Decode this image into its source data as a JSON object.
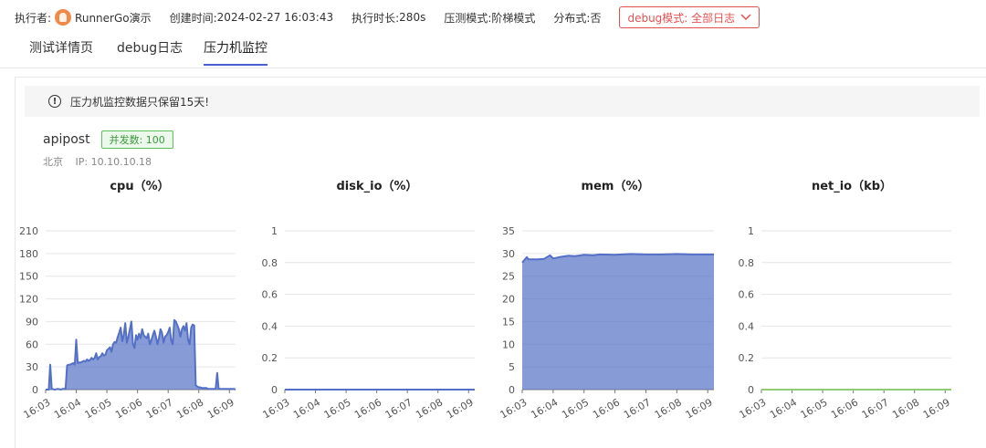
{
  "header": {
    "executor_label": "执行者:",
    "executor_name": "RunnerGo演示",
    "created_label": "创建时间:",
    "created_value": "2024-02-27 16:03:43",
    "duration_label": "执行时长:",
    "duration_value": "280s",
    "mode_label": "压测模式:",
    "mode_value": "阶梯模式",
    "distributed_label": "分布式:",
    "distributed_value": "否",
    "debug_select": "debug模式: 全部日志"
  },
  "tabs": [
    {
      "label": "测试详情页",
      "active": false
    },
    {
      "label": "debug日志",
      "active": false
    },
    {
      "label": "压力机监控",
      "active": true
    }
  ],
  "notice": {
    "icon": "exclamation-icon",
    "text": "压力机监控数据只保留15天!"
  },
  "machine": {
    "name": "apipost",
    "concurrency": "并发数: 100",
    "region": "北京",
    "ip": "IP: 10.10.10.18"
  },
  "chart_data": [
    {
      "type": "area",
      "title": "cpu（%）",
      "x_ticks": [
        "16:03",
        "16:04",
        "16:05",
        "16:06",
        "16:07",
        "16:08",
        "16:09"
      ],
      "y_ticks": [
        0,
        30,
        60,
        90,
        120,
        150,
        180,
        210
      ],
      "ylim": [
        0,
        210
      ],
      "color": "#5470c6",
      "x": [
        0,
        0.1,
        0.15,
        0.2,
        0.3,
        0.4,
        0.5,
        0.55,
        0.6,
        0.65,
        0.7,
        0.75,
        0.8,
        0.85,
        0.9,
        0.95,
        1,
        1.05,
        1.1,
        1.15,
        1.2,
        1.25,
        1.3,
        1.35,
        1.4,
        1.45,
        1.5,
        1.55,
        1.6,
        1.65,
        1.7,
        1.75,
        1.8,
        1.85,
        1.9,
        1.95,
        2,
        2.05,
        2.1,
        2.15,
        2.2,
        2.25,
        2.3,
        2.35,
        2.4,
        2.45,
        2.5,
        2.55,
        2.6,
        2.65,
        2.7,
        2.75,
        2.8,
        2.85,
        2.9,
        2.95,
        3,
        3.05,
        3.1,
        3.15,
        3.2,
        3.25,
        3.3,
        3.35,
        3.4,
        3.45,
        3.5,
        3.55,
        3.6,
        3.65,
        3.7,
        3.75,
        3.8,
        3.85,
        3.9,
        3.95,
        4,
        4.05,
        4.1,
        4.15,
        4.2,
        4.25,
        4.3,
        4.35,
        4.4,
        4.45,
        4.5,
        4.55,
        4.6,
        4.65,
        4.7,
        4.75,
        4.8,
        4.85,
        4.9,
        4.95,
        5,
        5.05,
        5.1,
        5.15,
        5.2,
        5.25,
        5.3,
        5.35,
        5.4,
        5.45,
        5.5,
        5.55,
        5.6,
        5.65,
        5.7,
        5.75,
        5.8,
        5.85,
        5.9,
        5.95,
        6,
        6.05,
        6.1,
        6.15,
        6.2
      ],
      "y": [
        0,
        0,
        33,
        1,
        0,
        1,
        0,
        1,
        1,
        1,
        32,
        33,
        33,
        34,
        35,
        33,
        66,
        35,
        36,
        36,
        37,
        38,
        37,
        40,
        38,
        39,
        42,
        40,
        42,
        48,
        40,
        43,
        44,
        48,
        45,
        46,
        52,
        54,
        56,
        50,
        60,
        63,
        62,
        69,
        75,
        82,
        64,
        72,
        88,
        62,
        70,
        80,
        90,
        61,
        55,
        72,
        66,
        74,
        68,
        80,
        72,
        70,
        68,
        74,
        60,
        65,
        72,
        78,
        70,
        60,
        68,
        80,
        75,
        62,
        70,
        72,
        76,
        82,
        65,
        60,
        92,
        90,
        85,
        80,
        70,
        80,
        84,
        78,
        88,
        66,
        60,
        82,
        86,
        85,
        6,
        4,
        3,
        3,
        2,
        2,
        2,
        2,
        1,
        1,
        1,
        1,
        1,
        1,
        22,
        1,
        1,
        1,
        1,
        1,
        1,
        1,
        1,
        1,
        1,
        1,
        0
      ]
    },
    {
      "type": "line",
      "title": "disk_io（%）",
      "x_ticks": [
        "16:03",
        "16:04",
        "16:05",
        "16:06",
        "16:07",
        "16:08",
        "16:09"
      ],
      "y_ticks": [
        0,
        0.2,
        0.4,
        0.6,
        0.8,
        1
      ],
      "ylim": [
        0,
        1
      ],
      "color": "#5470c6",
      "x": [
        0,
        6.2
      ],
      "y": [
        0,
        0
      ]
    },
    {
      "type": "area",
      "title": "mem（%）",
      "x_ticks": [
        "16:03",
        "16:04",
        "16:05",
        "16:06",
        "16:07",
        "16:08",
        "16:09"
      ],
      "y_ticks": [
        0,
        5,
        10,
        15,
        20,
        25,
        30,
        35
      ],
      "ylim": [
        0,
        35
      ],
      "color": "#5470c6",
      "x": [
        0,
        0.1,
        0.15,
        0.2,
        0.5,
        0.7,
        0.9,
        1.0,
        1.2,
        1.5,
        1.7,
        2,
        2.3,
        2.5,
        3,
        3.5,
        4,
        4.5,
        5,
        5.5,
        6,
        6.2
      ],
      "y": [
        28,
        28.8,
        29.2,
        28.7,
        28.7,
        28.8,
        29.6,
        28.9,
        29.2,
        29.5,
        29.4,
        29.7,
        29.6,
        29.8,
        29.7,
        29.9,
        29.8,
        29.8,
        29.9,
        29.8,
        29.8,
        29.8
      ]
    },
    {
      "type": "line",
      "title": "net_io（kb）",
      "x_ticks": [
        "16:03",
        "16:04",
        "16:05",
        "16:06",
        "16:07",
        "16:08",
        "16:09"
      ],
      "y_ticks": [
        0,
        0.2,
        0.4,
        0.6,
        0.8,
        1
      ],
      "ylim": [
        0,
        1
      ],
      "color": "#91cc75",
      "x": [
        0,
        6.2
      ],
      "y": [
        0,
        0
      ]
    }
  ]
}
